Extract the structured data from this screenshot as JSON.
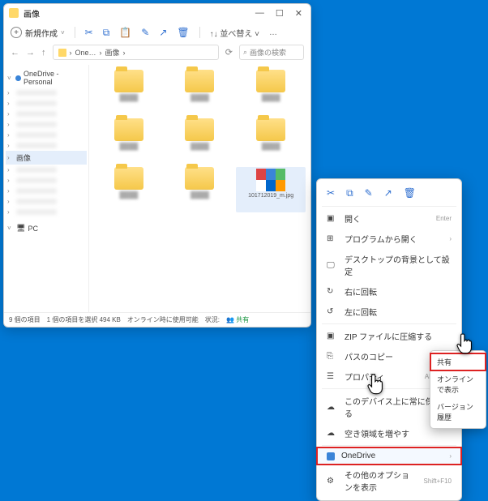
{
  "window": {
    "title": "画像",
    "controls": {
      "min": "—",
      "max": "☐",
      "close": "✕"
    }
  },
  "toolbar": {
    "new_label": "新規作成",
    "sort_label": "並べ替え",
    "more": "…"
  },
  "nav": {
    "back": "←",
    "fwd": "→",
    "up": "↑",
    "seg1": "One…",
    "seg2": "画像",
    "search_placeholder": "画像の検索"
  },
  "tree": {
    "root": "OneDrive - Personal",
    "selected": "画像",
    "pc": "PC"
  },
  "file": {
    "name": "101712019_m.jpg"
  },
  "status": {
    "count": "9 個の項目",
    "selected": "1 個の項目を選択  494 KB",
    "online": "オンライン時に使用可能",
    "state_label": "状況:",
    "state": "共有"
  },
  "ctx": {
    "open": "開く",
    "open_hint": "Enter",
    "open_with": "プログラムから開く",
    "set_bg": "デスクトップの背景として設定",
    "rot_r": "右に回転",
    "rot_l": "左に回転",
    "zip": "ZIP ファイルに圧縮する",
    "copy_path": "パスのコピー",
    "props": "プロパティ",
    "props_hint": "Alt+Enter",
    "keep_device": "このデバイス上に常に保持する",
    "free_space": "空き領域を増やす",
    "onedrive": "OneDrive",
    "more_opts": "その他のオプションを表示",
    "more_hint": "Shift+F10"
  },
  "sub": {
    "share": "共有",
    "view_online": "オンラインで表示",
    "version": "バージョン履歴"
  }
}
